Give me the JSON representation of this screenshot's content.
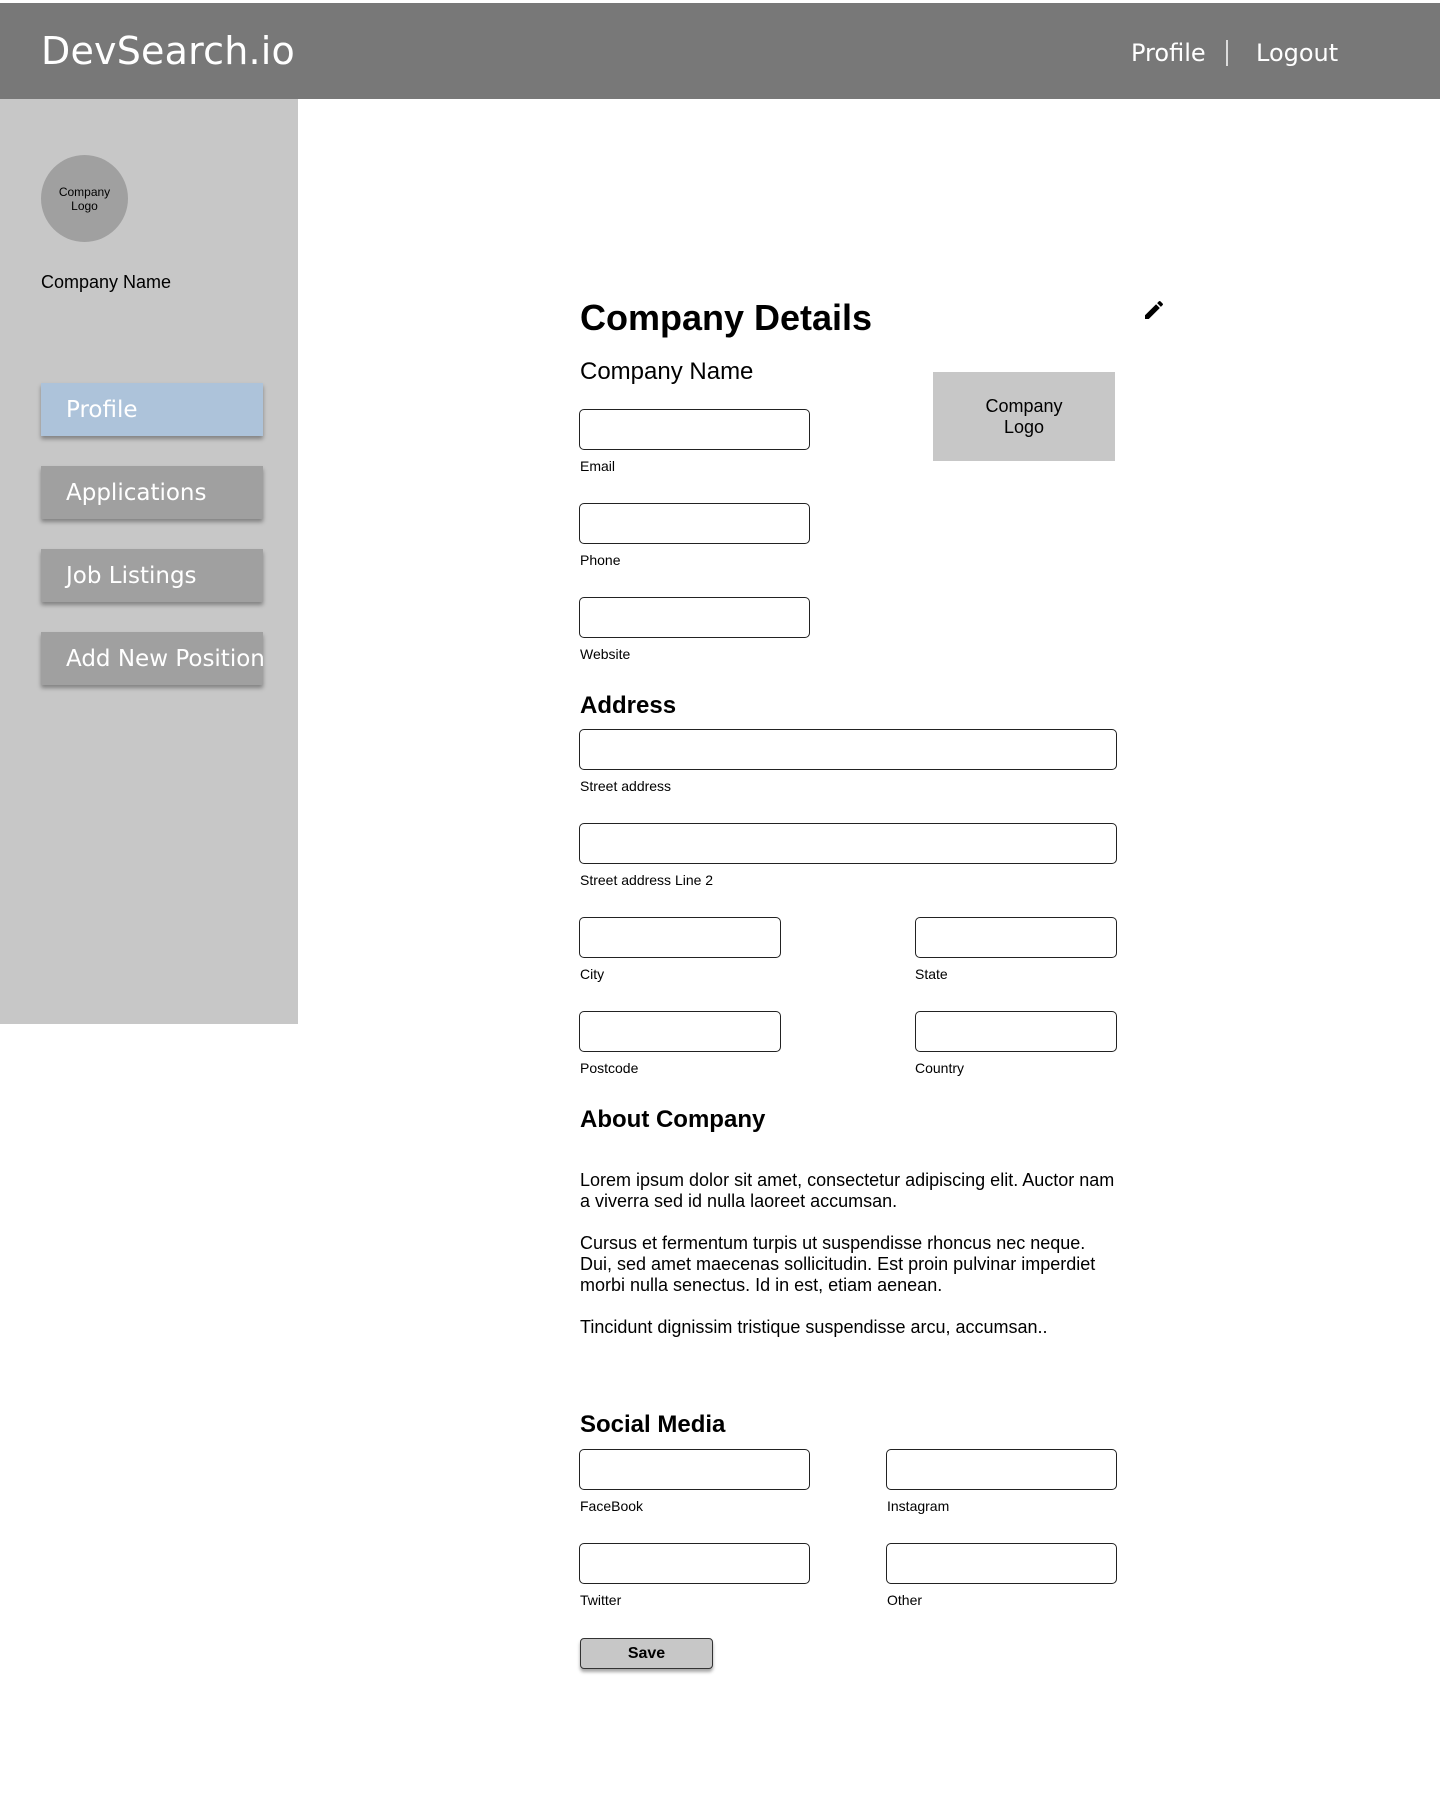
{
  "header": {
    "brand": "DevSearch.io",
    "nav": {
      "profile": "Profile",
      "logout": "Logout"
    }
  },
  "sidebar": {
    "logo_text": "Company\nLogo",
    "company_name": "Company Name",
    "items": [
      {
        "label": "Profile",
        "active": true
      },
      {
        "label": "Applications",
        "active": false
      },
      {
        "label": "Job Listings",
        "active": false
      },
      {
        "label": "Add New Position",
        "active": false
      }
    ]
  },
  "main": {
    "title": "Company Details",
    "company_name": "Company Name",
    "logo_text": "Company\nLogo",
    "contact": {
      "email": "Email",
      "phone": "Phone",
      "website": "Website"
    },
    "address": {
      "title": "Address",
      "street": "Street address",
      "street2": "Street address Line 2",
      "city": "City",
      "state": "State",
      "postcode": "Postcode",
      "country": "Country"
    },
    "about": {
      "title": "About Company",
      "paragraphs": [
        "Lorem ipsum dolor sit amet, consectetur adipiscing elit. Auctor nam a viverra sed id nulla laoreet accumsan.",
        "Cursus et fermentum turpis ut suspendisse rhoncus nec neque. Dui, sed amet maecenas sollicitudin. Est proin pulvinar imperdiet morbi nulla senectus. Id in est, etiam aenean.",
        "Tincidunt dignissim tristique suspendisse arcu, accumsan.."
      ]
    },
    "social": {
      "title": "Social Media",
      "facebook": "FaceBook",
      "instagram": "Instagram",
      "twitter": "Twitter",
      "other": "Other"
    },
    "save_label": "Save"
  },
  "colors": {
    "header_bg": "#787878",
    "sidebar_bg": "#c7c7c7",
    "button_bg": "#a0a0a0",
    "active_button_bg": "#adc3da"
  },
  "icons": {
    "edit": "pencil-icon"
  }
}
